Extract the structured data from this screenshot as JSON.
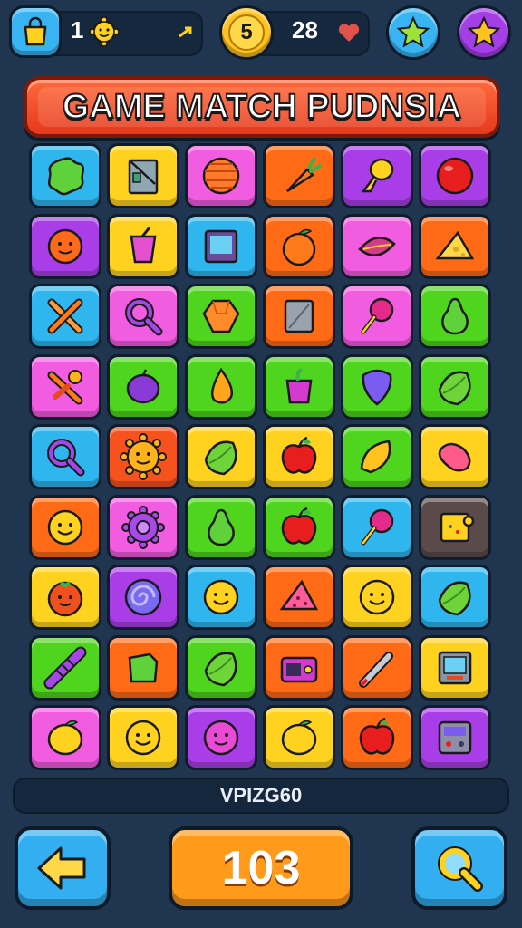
{
  "top_bar": {
    "bag_count": "1",
    "coin_label": "5",
    "lives_count": "28"
  },
  "title": "GAME MATCH PUDNSIA",
  "status_text": "VPIZG60",
  "score": "103",
  "colors": {
    "blue": "#2fb6ef",
    "yellow": "#ffd21f",
    "pink": "#f15ce0",
    "orange": "#ff6a16",
    "purple": "#a93ee8",
    "green": "#4fd51e",
    "red": "#f5521e",
    "brown": "#5a4a4a"
  },
  "grid": [
    [
      {
        "color": "blue",
        "icon": "green-splat-icon"
      },
      {
        "color": "yellow",
        "icon": "notebook-icon"
      },
      {
        "color": "pink",
        "icon": "orange-ball-icon"
      },
      {
        "color": "orange",
        "icon": "carrot-icon"
      },
      {
        "color": "purple",
        "icon": "yellow-balloon-icon"
      },
      {
        "color": "purple",
        "icon": "red-ball-icon"
      }
    ],
    [
      {
        "color": "purple",
        "icon": "orange-gear-face-icon"
      },
      {
        "color": "yellow",
        "icon": "pink-cup-icon"
      },
      {
        "color": "blue",
        "icon": "tablet-icon"
      },
      {
        "color": "orange",
        "icon": "orange-fruit-icon"
      },
      {
        "color": "pink",
        "icon": "leaf-icon"
      },
      {
        "color": "orange",
        "icon": "cheese-icon"
      }
    ],
    [
      {
        "color": "blue",
        "icon": "crossed-sticks-icon"
      },
      {
        "color": "pink",
        "icon": "magnifier-icon"
      },
      {
        "color": "green",
        "icon": "orange-gem-icon"
      },
      {
        "color": "orange",
        "icon": "gray-card-icon"
      },
      {
        "color": "pink",
        "icon": "lollipop-icon"
      },
      {
        "color": "green",
        "icon": "green-pear-icon"
      }
    ],
    [
      {
        "color": "pink",
        "icon": "tools-icon"
      },
      {
        "color": "green",
        "icon": "purple-plum-icon"
      },
      {
        "color": "green",
        "icon": "orange-drop-icon"
      },
      {
        "color": "green",
        "icon": "pink-pot-icon"
      },
      {
        "color": "green",
        "icon": "purple-gem-icon"
      },
      {
        "color": "green",
        "icon": "green-leaf-icon"
      }
    ],
    [
      {
        "color": "blue",
        "icon": "magnifier-icon"
      },
      {
        "color": "red",
        "icon": "sun-face-icon"
      },
      {
        "color": "yellow",
        "icon": "green-leaf-icon"
      },
      {
        "color": "yellow",
        "icon": "apple-icon"
      },
      {
        "color": "green",
        "icon": "yellow-lemon-icon"
      },
      {
        "color": "yellow",
        "icon": "pink-candy-icon"
      }
    ],
    [
      {
        "color": "orange",
        "icon": "smiley-icon"
      },
      {
        "color": "pink",
        "icon": "gear-icon"
      },
      {
        "color": "green",
        "icon": "green-pear-icon"
      },
      {
        "color": "green",
        "icon": "apple-icon"
      },
      {
        "color": "blue",
        "icon": "lollipop-icon"
      },
      {
        "color": "brown",
        "icon": "puzzle-icon"
      }
    ],
    [
      {
        "color": "yellow",
        "icon": "tomato-face-icon"
      },
      {
        "color": "purple",
        "icon": "swirl-icon"
      },
      {
        "color": "blue",
        "icon": "smiley-icon"
      },
      {
        "color": "orange",
        "icon": "cake-slice-icon"
      },
      {
        "color": "yellow",
        "icon": "smiley-icon"
      },
      {
        "color": "blue",
        "icon": "green-leaf-icon"
      }
    ],
    [
      {
        "color": "green",
        "icon": "purple-brush-icon"
      },
      {
        "color": "orange",
        "icon": "green-card-icon"
      },
      {
        "color": "green",
        "icon": "green-leaf-icon"
      },
      {
        "color": "orange",
        "icon": "radio-icon"
      },
      {
        "color": "orange",
        "icon": "pen-icon"
      },
      {
        "color": "yellow",
        "icon": "tv-icon"
      }
    ],
    [
      {
        "color": "pink",
        "icon": "lemon-icon"
      },
      {
        "color": "yellow",
        "icon": "smiley-icon"
      },
      {
        "color": "purple",
        "icon": "pink-face-icon"
      },
      {
        "color": "yellow",
        "icon": "lemon-icon"
      },
      {
        "color": "orange",
        "icon": "apple-icon"
      },
      {
        "color": "purple",
        "icon": "calculator-icon"
      }
    ]
  ]
}
